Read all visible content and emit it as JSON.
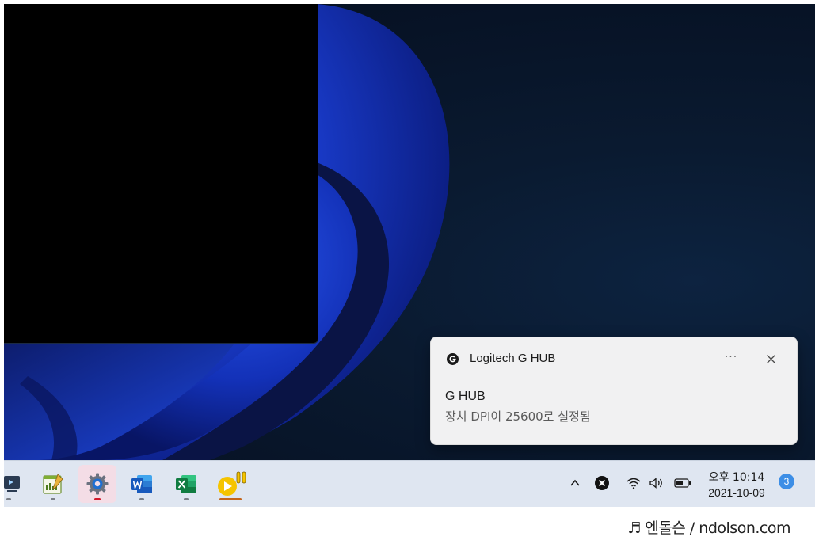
{
  "toast": {
    "app_name": "Logitech G HUB",
    "more_label": "···",
    "title": "G HUB",
    "body": "장치 DPI이 25600로 설정됨",
    "app_icon": "logitech-g-icon",
    "close_icon": "close-icon"
  },
  "taskbar": {
    "apps": [
      {
        "name": "partial-app",
        "icon": "partial-app-icon"
      },
      {
        "name": "notepad",
        "icon": "notepad-chart-icon"
      },
      {
        "name": "settings",
        "icon": "gear-icon",
        "active": true
      },
      {
        "name": "word",
        "icon": "word-icon"
      },
      {
        "name": "excel",
        "icon": "excel-icon"
      },
      {
        "name": "media-player",
        "icon": "media-player-icon"
      }
    ],
    "tray": {
      "show_hidden_icon": "chevron-up-icon",
      "tray_app_icon": "close-circle-icon",
      "wifi_icon": "wifi-icon",
      "volume_icon": "volume-icon",
      "battery_icon": "battery-icon"
    },
    "clock": {
      "time": "오후 10:14",
      "date": "2021-10-09"
    },
    "notification_count": "3"
  },
  "watermark": {
    "text": "♬ 엔돌슨 / ndolson.com"
  },
  "colors": {
    "taskbar_bg": "#dfe6f1",
    "toast_bg": "#f1f1f2",
    "badge": "#3d8ee6",
    "wallpaper_blue": "#1a3fd1"
  }
}
